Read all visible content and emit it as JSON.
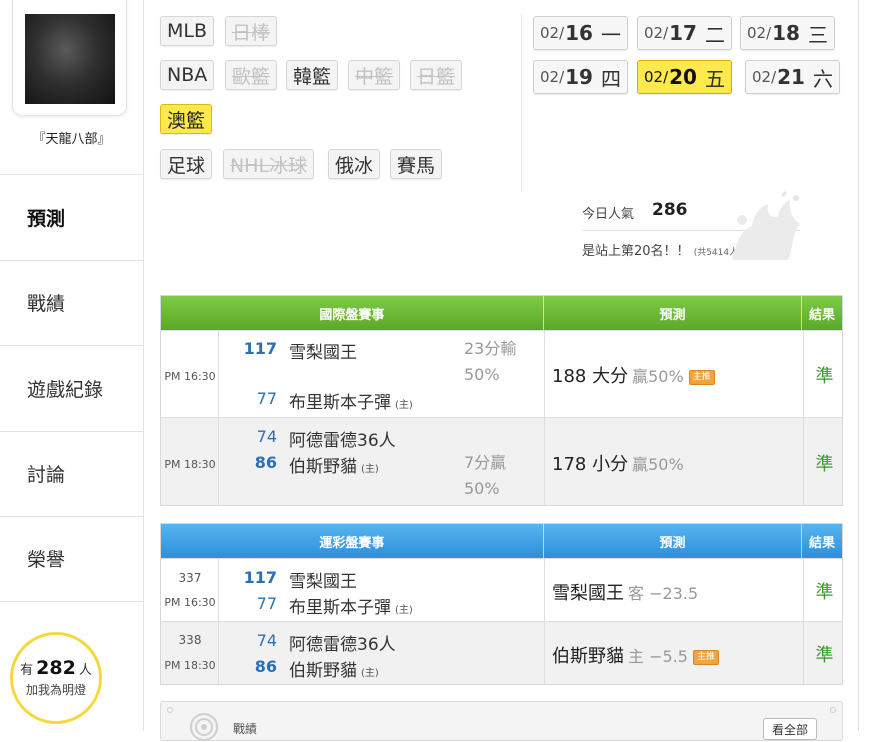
{
  "user": {
    "name": "『天龍八部』"
  },
  "nav": [
    {
      "label": "預測"
    },
    {
      "label": "戰績"
    },
    {
      "label": "遊戲紀錄"
    },
    {
      "label": "討論"
    },
    {
      "label": "榮譽"
    }
  ],
  "fans": {
    "prefix": "有",
    "count": "282",
    "unit": "人",
    "cta": "加我為明燈"
  },
  "leagues": {
    "row1": [
      {
        "label": "MLB"
      },
      {
        "label": "日棒"
      }
    ],
    "row2": [
      {
        "label": "NBA"
      },
      {
        "label": "歐籃"
      },
      {
        "label": "韓籃"
      },
      {
        "label": "中籃"
      },
      {
        "label": "日籃"
      }
    ],
    "row3": [
      {
        "label": "澳籃"
      }
    ],
    "row4": [
      {
        "label": "足球"
      },
      {
        "label": "NHL冰球"
      },
      {
        "label": "俄冰"
      },
      {
        "label": "賽馬"
      }
    ]
  },
  "dates": [
    {
      "mon": "02/",
      "day": "16",
      "wd": "一"
    },
    {
      "mon": "02/",
      "day": "17",
      "wd": "二"
    },
    {
      "mon": "02/",
      "day": "18",
      "wd": "三"
    },
    {
      "mon": "02/",
      "day": "19",
      "wd": "四"
    },
    {
      "mon": "02/",
      "day": "20",
      "wd": "五"
    },
    {
      "mon": "02/",
      "day": "21",
      "wd": "六"
    }
  ],
  "popularity": {
    "label": "今日人氣",
    "value": "286",
    "rank_text": "是站上第20名！！",
    "rank_sub": "(共5414人)"
  },
  "intl_table": {
    "headers": {
      "game": "國際盤賽事",
      "pred": "預測",
      "result": "結果"
    },
    "rows": [
      {
        "time": "PM 16:30",
        "away_score": "117",
        "away_team": "雪梨國王",
        "home_score": "77",
        "home_team": "布里斯本子彈",
        "home_mark": "(主)",
        "margin1": "23分輸",
        "margin2": "50%",
        "pred_main": "188 大分",
        "pred_sub": "贏50%",
        "tag": "主推",
        "result": "準"
      },
      {
        "time": "PM 18:30",
        "away_score": "74",
        "away_team": "阿德雷德36人",
        "home_score": "86",
        "home_team": "伯斯野貓",
        "home_mark": "(主)",
        "margin1": "7分贏",
        "margin2": "50%",
        "pred_main": "178 小分",
        "pred_sub": "贏50%",
        "result": "準"
      }
    ]
  },
  "sports_table": {
    "headers": {
      "game": "運彩盤賽事",
      "pred": "預測",
      "result": "結果"
    },
    "rows": [
      {
        "id": "337",
        "time": "PM 16:30",
        "away_score": "117",
        "away_team": "雪梨國王",
        "home_score": "77",
        "home_team": "布里斯本子彈",
        "home_mark": "(主)",
        "pred_main": "雪梨國王",
        "pred_sub": "客 −23.5",
        "result": "準"
      },
      {
        "id": "338",
        "time": "PM 18:30",
        "away_score": "74",
        "away_team": "阿德雷德36人",
        "home_score": "86",
        "home_team": "伯斯野貓",
        "home_mark": "(主)",
        "pred_main": "伯斯野貓",
        "pred_sub": "主 −5.5",
        "tag": "主推",
        "result": "準"
      }
    ]
  },
  "record": {
    "title": "戰績",
    "see_all": "看全部"
  },
  "colors": {
    "green_head": "#5ba828",
    "blue_head": "#2d8fdc",
    "active_yellow": "#fde84d",
    "win_green": "#3a9a2e",
    "score_blue": "#2a6fb8",
    "tag_orange": "#f0a43c"
  }
}
